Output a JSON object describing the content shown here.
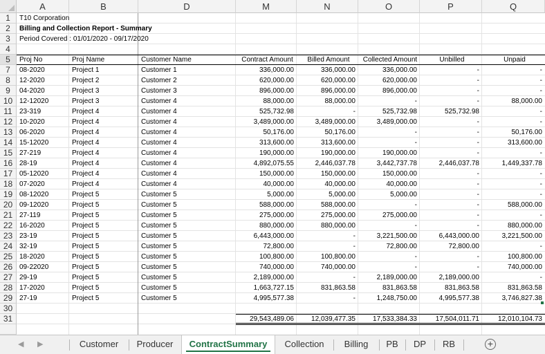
{
  "columns": [
    "A",
    "B",
    "D",
    "M",
    "N",
    "O",
    "P",
    "Q"
  ],
  "row_numbers": [
    "1",
    "2",
    "3",
    "4",
    "5",
    "7",
    "8",
    "9",
    "10",
    "11",
    "12",
    "13",
    "14",
    "15",
    "16",
    "17",
    "18",
    "19",
    "20",
    "21",
    "22",
    "23",
    "24",
    "25",
    "26",
    "27",
    "28",
    "29",
    "30",
    "31"
  ],
  "report": {
    "company": "T10 Corporation",
    "title": "Billing and Collection Report - Summary",
    "period": "Period Covered : 01/01/2020 - 09/17/2020"
  },
  "table": {
    "headers": [
      "Proj No",
      "Proj Name",
      "Customer Name",
      "Contract Amount",
      "Billed Amount",
      "Collected Amount",
      "Unbilled",
      "Unpaid"
    ],
    "rows": [
      [
        "08-2020",
        "Project 1",
        "Customer 1",
        "336,000.00",
        "336,000.00",
        "336,000.00",
        "-",
        "-"
      ],
      [
        "12-2020",
        "Project 2",
        "Customer 2",
        "620,000.00",
        "620,000.00",
        "620,000.00",
        "-",
        "-"
      ],
      [
        "04-2020",
        "Project 3",
        "Customer 3",
        "896,000.00",
        "896,000.00",
        "896,000.00",
        "-",
        "-"
      ],
      [
        "12-12020",
        "Project 3",
        "Customer 4",
        "88,000.00",
        "88,000.00",
        "-",
        "-",
        "88,000.00"
      ],
      [
        "23-319",
        "Project 4",
        "Customer 4",
        "525,732.98",
        "-",
        "525,732.98",
        "525,732.98",
        "-"
      ],
      [
        "10-2020",
        "Project 4",
        "Customer 4",
        "3,489,000.00",
        "3,489,000.00",
        "3,489,000.00",
        "-",
        "-"
      ],
      [
        "06-2020",
        "Project 4",
        "Customer 4",
        "50,176.00",
        "50,176.00",
        "-",
        "-",
        "50,176.00"
      ],
      [
        "15-12020",
        "Project 4",
        "Customer 4",
        "313,600.00",
        "313,600.00",
        "-",
        "-",
        "313,600.00"
      ],
      [
        "27-219",
        "Project 4",
        "Customer 4",
        "190,000.00",
        "190,000.00",
        "190,000.00",
        "-",
        "-"
      ],
      [
        "28-19",
        "Project 4",
        "Customer 4",
        "4,892,075.55",
        "2,446,037.78",
        "3,442,737.78",
        "2,446,037.78",
        "1,449,337.78"
      ],
      [
        "05-12020",
        "Project 4",
        "Customer 4",
        "150,000.00",
        "150,000.00",
        "150,000.00",
        "-",
        "-"
      ],
      [
        "07-2020",
        "Project 4",
        "Customer 4",
        "40,000.00",
        "40,000.00",
        "40,000.00",
        "-",
        "-"
      ],
      [
        "08-12020",
        "Project 5",
        "Customer 5",
        "5,000.00",
        "5,000.00",
        "5,000.00",
        "-",
        "-"
      ],
      [
        "09-12020",
        "Project 5",
        "Customer 5",
        "588,000.00",
        "588,000.00",
        "-",
        "-",
        "588,000.00"
      ],
      [
        "27-119",
        "Project 5",
        "Customer 5",
        "275,000.00",
        "275,000.00",
        "275,000.00",
        "-",
        "-"
      ],
      [
        "16-2020",
        "Project 5",
        "Customer 5",
        "880,000.00",
        "880,000.00",
        "-",
        "-",
        "880,000.00"
      ],
      [
        "23-19",
        "Project 5",
        "Customer 5",
        "6,443,000.00",
        "-",
        "3,221,500.00",
        "6,443,000.00",
        "3,221,500.00"
      ],
      [
        "32-19",
        "Project 5",
        "Customer 5",
        "72,800.00",
        "-",
        "72,800.00",
        "72,800.00",
        "-"
      ],
      [
        "18-2020",
        "Project 5",
        "Customer 5",
        "100,800.00",
        "100,800.00",
        "-",
        "-",
        "100,800.00"
      ],
      [
        "09-22020",
        "Project 5",
        "Customer 5",
        "740,000.00",
        "740,000.00",
        "-",
        "-",
        "740,000.00"
      ],
      [
        "29-19",
        "Project 5",
        "Customer 5",
        "2,189,000.00",
        "-",
        "2,189,000.00",
        "2,189,000.00",
        "-"
      ],
      [
        "17-2020",
        "Project 5",
        "Customer 5",
        "1,663,727.15",
        "831,863.58",
        "831,863.58",
        "831,863.58",
        "831,863.58"
      ],
      [
        "27-19",
        "Project 5",
        "Customer 5",
        "4,995,577.38",
        "-",
        "1,248,750.00",
        "4,995,577.38",
        "3,746,827.38"
      ]
    ],
    "totals": [
      "29,543,489.06",
      "12,039,477.35",
      "17,533,384.33",
      "17,504,011.71",
      "12,010,104.73"
    ]
  },
  "tabs": [
    "Customer",
    "Producer",
    "ContractSummary",
    "Collection",
    "Billing",
    "PB",
    "DP",
    "RB"
  ],
  "active_tab": "ContractSummary",
  "icons": {
    "prev": "prev-sheet-icon",
    "next": "next-sheet-icon",
    "add": "add-sheet-icon"
  },
  "colors": {
    "accent": "#217346"
  }
}
